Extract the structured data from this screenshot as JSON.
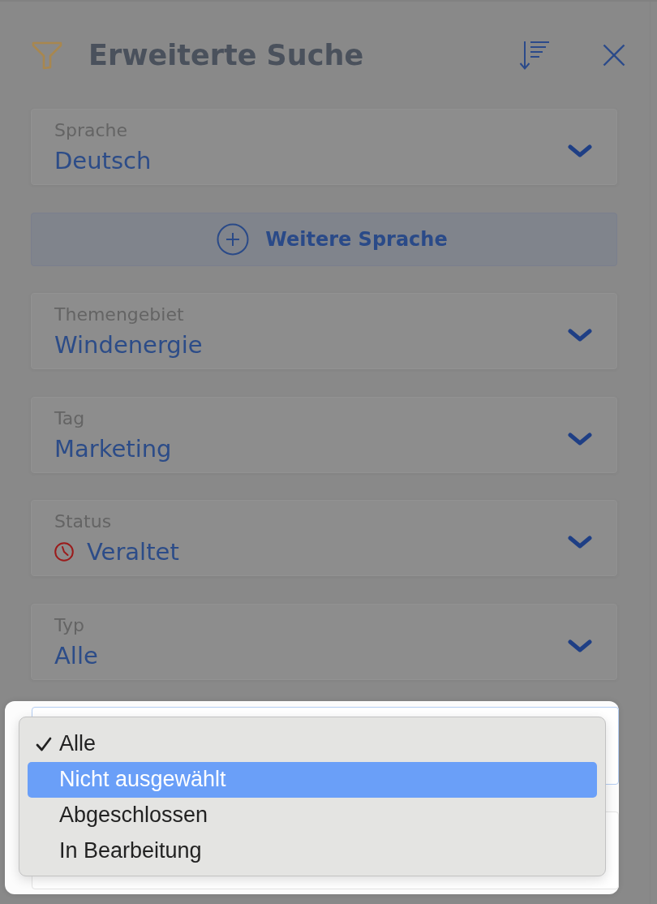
{
  "header": {
    "title": "Erweiterte Suche"
  },
  "filters": [
    {
      "kind": "select",
      "label": "Sprache",
      "value": "Deutsch"
    },
    {
      "kind": "add_button",
      "label": "Weitere Sprache"
    },
    {
      "kind": "select",
      "label": "Themengebiet",
      "value": "Windenergie"
    },
    {
      "kind": "select",
      "label": "Tag",
      "value": "Marketing"
    },
    {
      "kind": "status_select",
      "label": "Status",
      "value": "Veraltet"
    },
    {
      "kind": "select",
      "label": "Typ",
      "value": "Alle"
    }
  ],
  "spotlight": {
    "fields": [
      {
        "focused": true
      },
      {
        "focused": false
      }
    ]
  },
  "dropdown_menu": {
    "options": [
      {
        "label": "Alle",
        "selected": true,
        "highlighted": false
      },
      {
        "label": "Nicht ausgewählt",
        "selected": false,
        "highlighted": true
      },
      {
        "label": "Abgeschlossen",
        "selected": false,
        "highlighted": false
      },
      {
        "label": "In Bearbeitung",
        "selected": false,
        "highlighted": false
      }
    ]
  }
}
